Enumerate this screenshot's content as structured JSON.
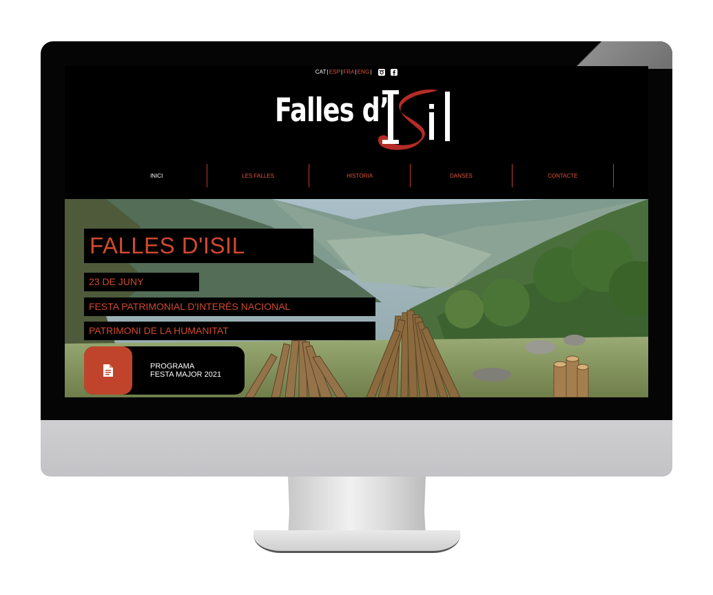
{
  "languages": [
    "CAT",
    "ESP",
    "FRA",
    "ENG"
  ],
  "logo": {
    "text": "Falles d'Isil"
  },
  "nav": [
    "INICI",
    "LES FALLES",
    "HISTÒRIA",
    "DANSES",
    "CONTACTE"
  ],
  "hero": {
    "title": "FALLES D'ISIL",
    "date": "23 DE JUNY",
    "line2": "FESTA PATRIMONIAL D'INTERÉS NACIONAL",
    "line3": "PATRIMONI DE LA HUMANITAT",
    "button": {
      "line1": "PROGRAMA",
      "line2": "FESTA MAJOR 2021"
    }
  },
  "colors": {
    "accent": "#c0442b",
    "accent_text": "#d2492f"
  },
  "icons": {
    "instagram": "instagram-icon",
    "facebook": "facebook-icon",
    "document": "document-icon"
  }
}
